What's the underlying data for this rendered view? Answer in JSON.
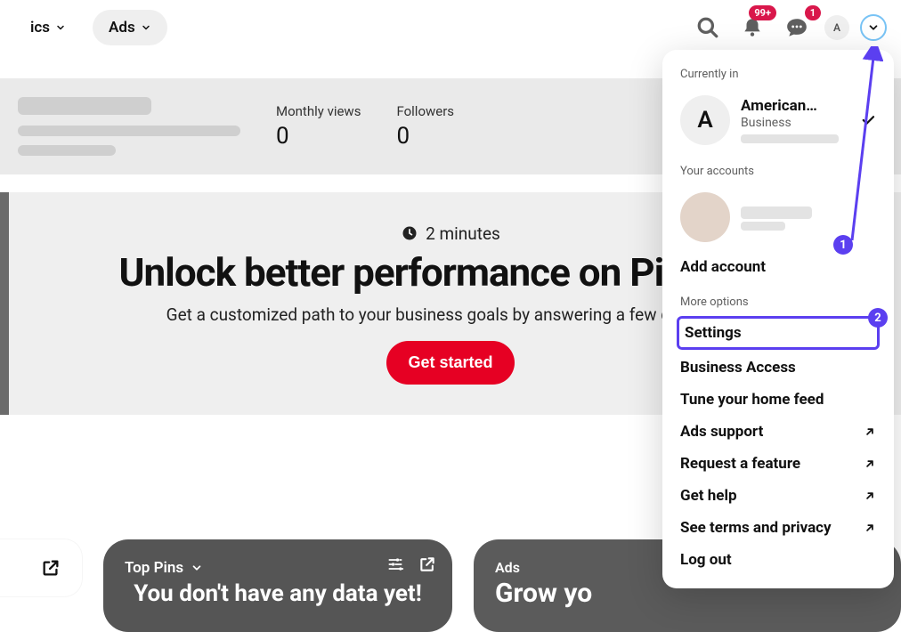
{
  "nav": {
    "analytics_label": "ics",
    "ads_label": "Ads"
  },
  "topbar": {
    "notifications_badge": "99+",
    "messages_badge": "1",
    "avatar_letter": "A"
  },
  "profile": {
    "monthly_views_label": "Monthly views",
    "monthly_views_value": "0",
    "followers_label": "Followers",
    "followers_value": "0"
  },
  "hero": {
    "time_text": "2 minutes",
    "title": "Unlock better performance on Pinterest",
    "subtitle": "Get a customized path to your business goals by answering a few questions",
    "cta": "Get started"
  },
  "cards": {
    "top_pins_label": "Top Pins",
    "no_data_title": "You don't have any data yet!",
    "ads_label": "Ads",
    "grow_title": "Grow yo"
  },
  "panel": {
    "currently_in": "Currently in",
    "acct_letter": "A",
    "acct_name": "American…",
    "acct_type": "Business",
    "your_accounts": "Your accounts",
    "add_account": "Add account",
    "more_options": "More options",
    "settings": "Settings",
    "business_access": "Business Access",
    "tune_feed": "Tune your home feed",
    "ads_support": "Ads support",
    "request_feature": "Request a feature",
    "get_help": "Get help",
    "terms": "See terms and privacy",
    "log_out": "Log out"
  },
  "annotations": {
    "step1": "1",
    "step2": "2"
  }
}
